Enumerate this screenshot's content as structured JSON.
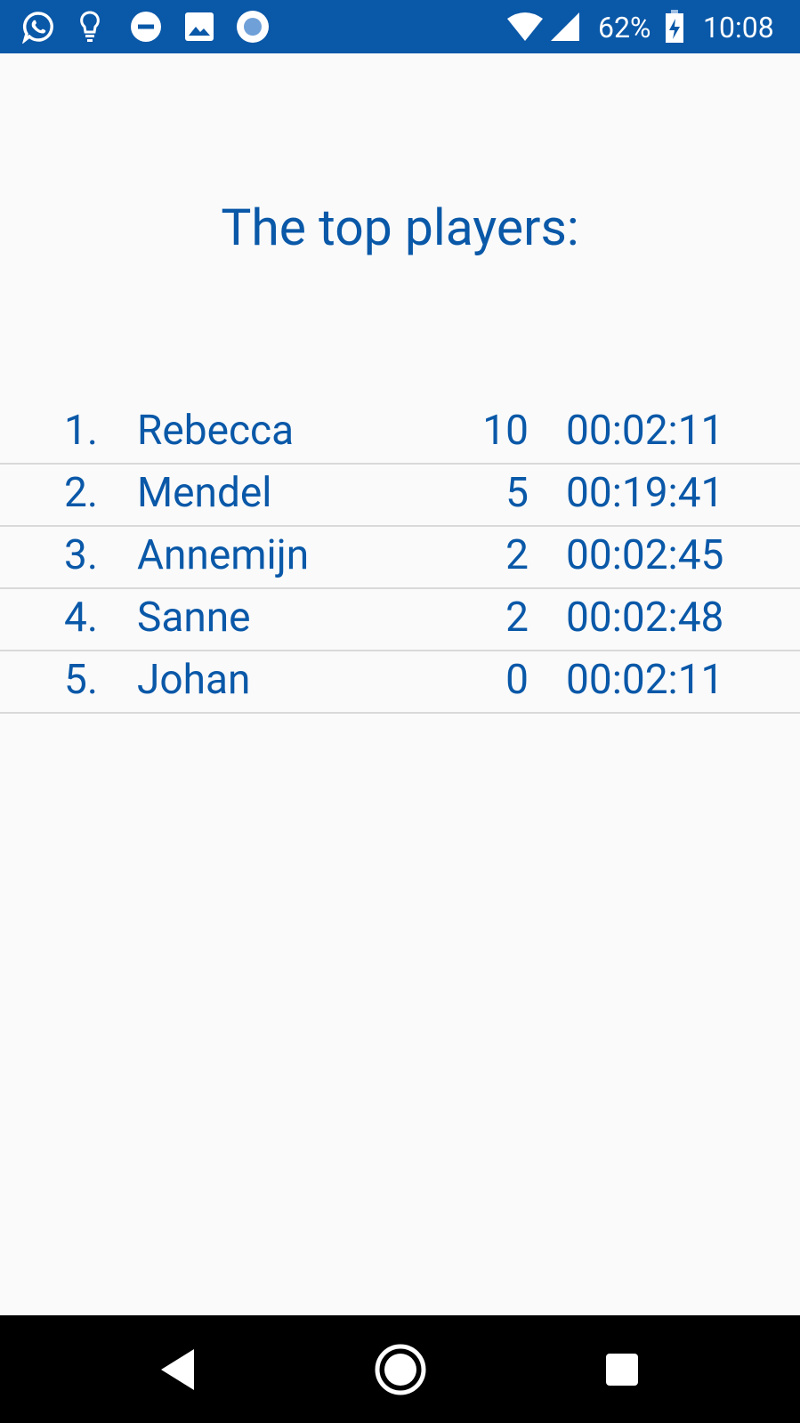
{
  "status_bar": {
    "notification_icons": [
      "whatsapp-icon",
      "lightbulb-icon",
      "do-not-disturb-icon",
      "image-icon",
      "record-icon"
    ],
    "system_icons": [
      "wifi-icon",
      "signal-icon",
      "battery-charging-icon"
    ],
    "battery": "62%",
    "time": "10:08"
  },
  "screen": {
    "title": "The top players:"
  },
  "leaderboard": [
    {
      "rank": "1.",
      "name": "Rebecca",
      "score": "10",
      "time": "00:02:11"
    },
    {
      "rank": "2.",
      "name": "Mendel",
      "score": "5",
      "time": "00:19:41"
    },
    {
      "rank": "3.",
      "name": "Annemijn",
      "score": "2",
      "time": "00:02:45"
    },
    {
      "rank": "4.",
      "name": "Sanne",
      "score": "2",
      "time": "00:02:48"
    },
    {
      "rank": "5.",
      "name": "Johan",
      "score": "0",
      "time": "00:02:11"
    }
  ],
  "nav_bar": {
    "buttons": [
      "back-icon",
      "home-icon",
      "recents-icon"
    ]
  },
  "colors": {
    "accent": "#0a58a8",
    "background": "#fafafa",
    "divider": "#d9d9d9",
    "nav_bar": "#000000"
  }
}
